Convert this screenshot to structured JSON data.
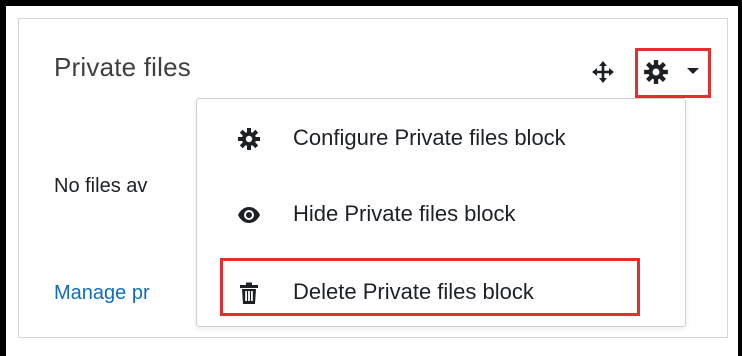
{
  "block": {
    "title": "Private files",
    "empty_text": "No files av",
    "manage_link": "Manage pr"
  },
  "header_icons": {
    "move": "move-icon",
    "actions": "gear-icon",
    "dropdown": "chevron-down-icon"
  },
  "menu": {
    "items": [
      {
        "label": "Configure Private files block",
        "icon": "gear-icon"
      },
      {
        "label": "Hide Private files block",
        "icon": "eye-icon"
      },
      {
        "label": "Delete Private files block",
        "icon": "trash-icon"
      }
    ]
  },
  "colors": {
    "highlight": "#e03030",
    "link": "#0f6cbf",
    "text": "#1d2125"
  }
}
